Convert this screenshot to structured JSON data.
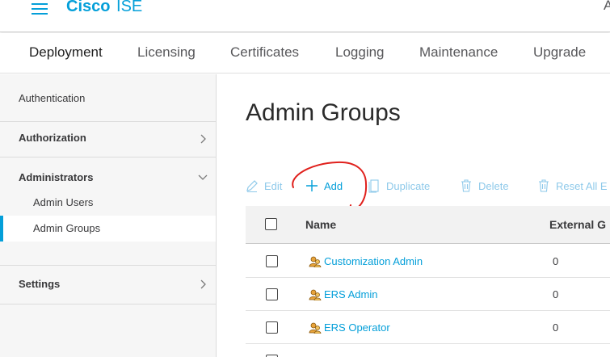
{
  "header": {
    "brand_bold": "Cisco",
    "product": "ISE",
    "right_text": "A",
    "brand_color": "#049fd9"
  },
  "tabs": [
    {
      "label": "Deployment",
      "active": true
    },
    {
      "label": "Licensing"
    },
    {
      "label": "Certificates"
    },
    {
      "label": "Logging"
    },
    {
      "label": "Maintenance"
    },
    {
      "label": "Upgrade"
    }
  ],
  "sidebar": {
    "authentication": "Authentication",
    "authorization": "Authorization",
    "administrators": "Administrators",
    "admin_users": "Admin Users",
    "admin_groups": "Admin Groups",
    "settings": "Settings",
    "selected": "Admin Groups"
  },
  "main": {
    "title": "Admin Groups",
    "toolbar": {
      "edit": "Edit",
      "add": "Add",
      "duplicate": "Duplicate",
      "delete": "Delete",
      "reset": "Reset All E"
    },
    "table": {
      "columns": [
        "Name",
        "External G"
      ],
      "rows": [
        {
          "name": "Customization Admin",
          "external": "0"
        },
        {
          "name": "ERS Admin",
          "external": "0"
        },
        {
          "name": "ERS Operator",
          "external": "0"
        }
      ]
    }
  },
  "icons": {
    "menu": "hamburger-menu-icon",
    "chevron_right": "chevron-right-icon",
    "chevron_down": "chevron-down-icon",
    "edit": "pencil-icon",
    "add": "plus-icon",
    "duplicate": "copy-icon",
    "delete": "trash-icon",
    "group": "user-group-icon"
  },
  "annotation_color": "#e0201c"
}
